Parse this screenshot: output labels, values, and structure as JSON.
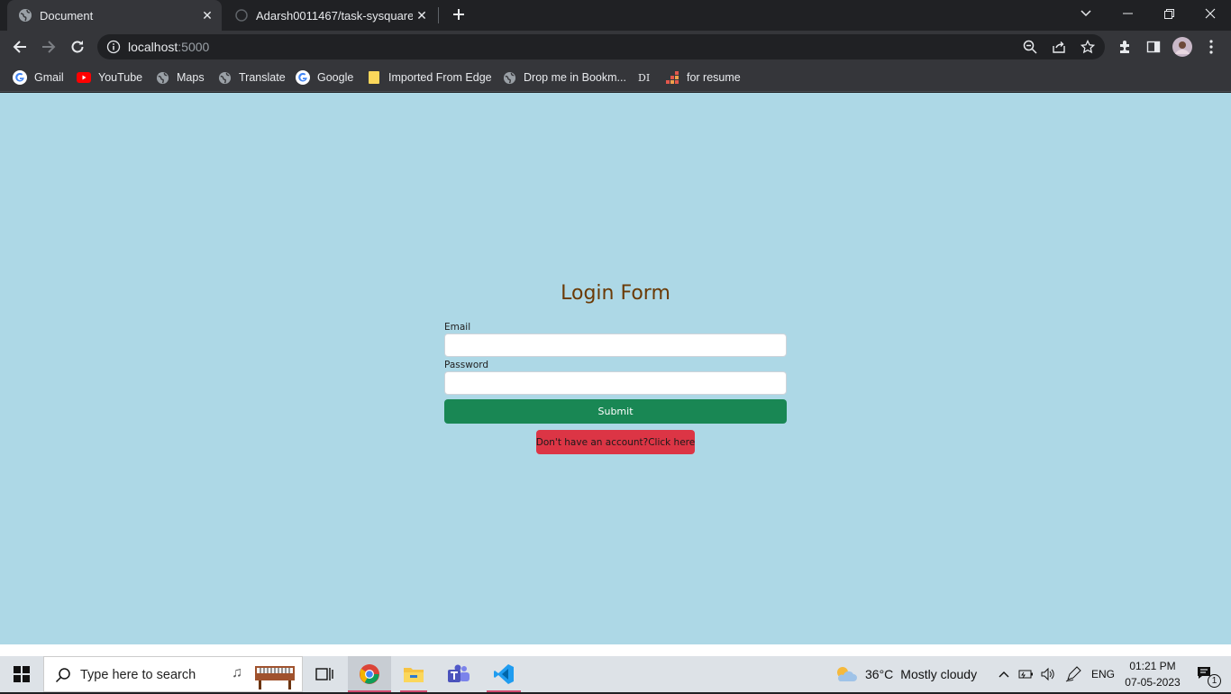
{
  "browser": {
    "tabs": [
      {
        "title": "Document",
        "active": true
      },
      {
        "title": "Adarsh0011467/task-sysquare",
        "active": false
      }
    ],
    "url_host": "localhost",
    "url_port": ":5000",
    "bookmarks": [
      {
        "label": "Gmail",
        "icon": "google-icon"
      },
      {
        "label": "YouTube",
        "icon": "youtube-icon"
      },
      {
        "label": "Maps",
        "icon": "globe-icon"
      },
      {
        "label": "Translate",
        "icon": "globe-icon"
      },
      {
        "label": "Google",
        "icon": "google-icon"
      },
      {
        "label": "Imported From Edge",
        "icon": "folder-icon"
      },
      {
        "label": "Drop me in Bookm...",
        "icon": "globe-icon"
      },
      {
        "label": "DI",
        "icon": ""
      },
      {
        "label": "for resume",
        "icon": "grid-icon"
      }
    ]
  },
  "page": {
    "background": "#add8e6",
    "title": "Login Form",
    "email_label": "Email",
    "email_value": "",
    "password_label": "Password",
    "password_value": "",
    "submit_label": "Submit",
    "signup_label": "Don't have an account?Click here",
    "colors": {
      "title": "#6b3a05",
      "submit": "#198754",
      "signup": "#dc3545"
    }
  },
  "taskbar": {
    "search_placeholder": "Type here to search",
    "weather_temp": "36°C",
    "weather_text": "Mostly cloudy",
    "language": "ENG",
    "time": "01:21 PM",
    "date": "07-05-2023",
    "notification_count": "1"
  }
}
